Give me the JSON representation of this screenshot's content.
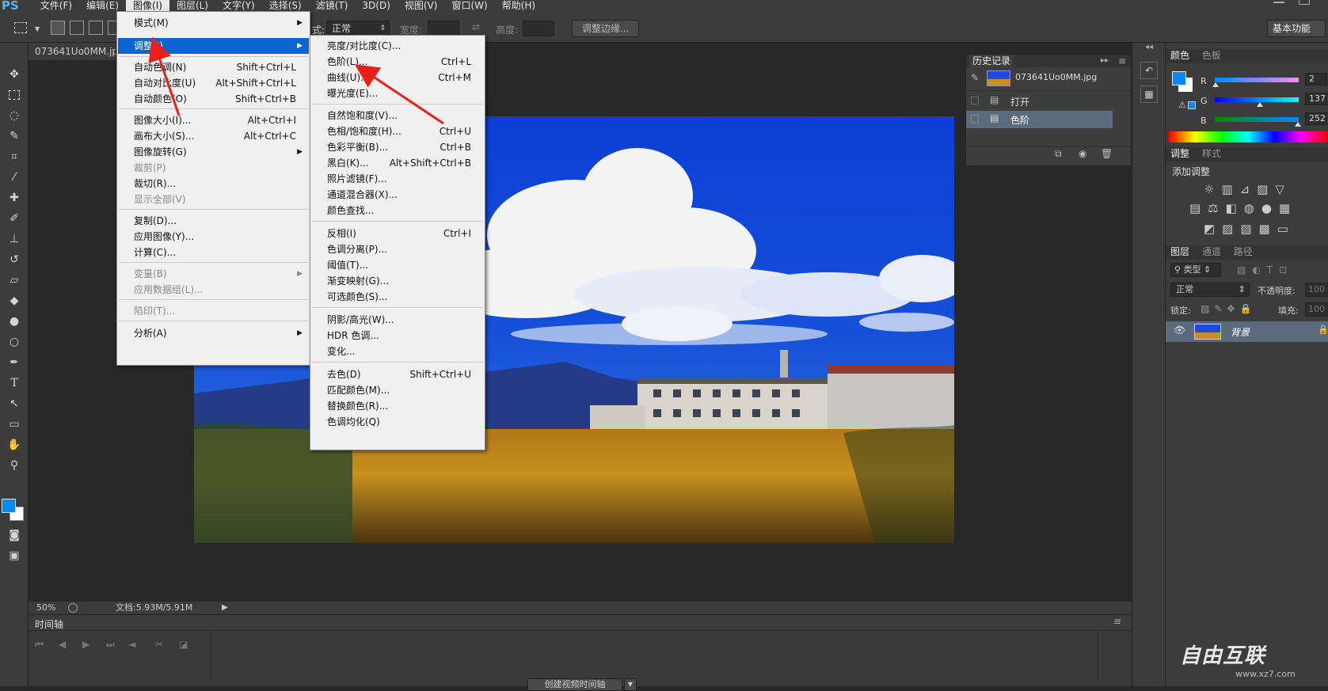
{
  "app": {
    "logo": "PS"
  },
  "menubar": [
    "文件(F)",
    "编辑(E)",
    "图像(I)",
    "图层(L)",
    "文字(Y)",
    "选择(S)",
    "滤镜(T)",
    "3D(D)",
    "视图(V)",
    "窗口(W)",
    "帮助(H)"
  ],
  "options": {
    "style_label": "式:",
    "style_value": "正常",
    "width_label": "宽度:",
    "height_label": "高度:",
    "refine_button": "调整边缘...",
    "workspace": "基本功能"
  },
  "document": {
    "tab_title": "073641Uo0MM.jpg",
    "zoom": "50%",
    "doc_info": "文档:5.93M/5.91M"
  },
  "timeline": {
    "title": "时间轴",
    "create_button": "创建视频时间轴"
  },
  "image_menu": [
    {
      "label": "模式(M)",
      "shortcut": "",
      "submenu": true,
      "disabled": false,
      "highlight": false
    },
    {
      "label": "调整(J)",
      "shortcut": "",
      "submenu": true,
      "disabled": false,
      "highlight": true
    },
    {
      "label": "自动色调(N)",
      "shortcut": "Shift+Ctrl+L",
      "submenu": false,
      "disabled": false,
      "highlight": false
    },
    {
      "label": "自动对比度(U)",
      "shortcut": "Alt+Shift+Ctrl+L",
      "submenu": false,
      "disabled": false,
      "highlight": false
    },
    {
      "label": "自动颜色(O)",
      "shortcut": "Shift+Ctrl+B",
      "submenu": false,
      "disabled": false,
      "highlight": false
    },
    {
      "label": "图像大小(I)...",
      "shortcut": "Alt+Ctrl+I",
      "submenu": false,
      "disabled": false,
      "highlight": false
    },
    {
      "label": "画布大小(S)...",
      "shortcut": "Alt+Ctrl+C",
      "submenu": false,
      "disabled": false,
      "highlight": false
    },
    {
      "label": "图像旋转(G)",
      "shortcut": "",
      "submenu": true,
      "disabled": false,
      "highlight": false
    },
    {
      "label": "裁剪(P)",
      "shortcut": "",
      "submenu": false,
      "disabled": true,
      "highlight": false
    },
    {
      "label": "裁切(R)...",
      "shortcut": "",
      "submenu": false,
      "disabled": false,
      "highlight": false
    },
    {
      "label": "显示全部(V)",
      "shortcut": "",
      "submenu": false,
      "disabled": true,
      "highlight": false
    },
    {
      "label": "复制(D)...",
      "shortcut": "",
      "submenu": false,
      "disabled": false,
      "highlight": false
    },
    {
      "label": "应用图像(Y)...",
      "shortcut": "",
      "submenu": false,
      "disabled": false,
      "highlight": false
    },
    {
      "label": "计算(C)...",
      "shortcut": "",
      "submenu": false,
      "disabled": false,
      "highlight": false
    },
    {
      "label": "变量(B)",
      "shortcut": "",
      "submenu": true,
      "disabled": true,
      "highlight": false
    },
    {
      "label": "应用数据组(L)...",
      "shortcut": "",
      "submenu": false,
      "disabled": true,
      "highlight": false
    },
    {
      "label": "陷印(T)...",
      "shortcut": "",
      "submenu": false,
      "disabled": true,
      "highlight": false
    },
    {
      "label": "分析(A)",
      "shortcut": "",
      "submenu": true,
      "disabled": false,
      "highlight": false
    }
  ],
  "adjust_menu": [
    {
      "label": "亮度/对比度(C)...",
      "shortcut": ""
    },
    {
      "label": "色阶(L)...",
      "shortcut": "Ctrl+L"
    },
    {
      "label": "曲线(U)...",
      "shortcut": "Ctrl+M"
    },
    {
      "label": "曝光度(E)...",
      "shortcut": ""
    },
    {
      "label": "自然饱和度(V)...",
      "shortcut": ""
    },
    {
      "label": "色相/饱和度(H)...",
      "shortcut": "Ctrl+U"
    },
    {
      "label": "色彩平衡(B)...",
      "shortcut": "Ctrl+B"
    },
    {
      "label": "黑白(K)...",
      "shortcut": "Alt+Shift+Ctrl+B"
    },
    {
      "label": "照片滤镜(F)...",
      "shortcut": ""
    },
    {
      "label": "通道混合器(X)...",
      "shortcut": ""
    },
    {
      "label": "颜色查找...",
      "shortcut": ""
    },
    {
      "label": "反相(I)",
      "shortcut": "Ctrl+I"
    },
    {
      "label": "色调分离(P)...",
      "shortcut": ""
    },
    {
      "label": "阈值(T)...",
      "shortcut": ""
    },
    {
      "label": "渐变映射(G)...",
      "shortcut": ""
    },
    {
      "label": "可选颜色(S)...",
      "shortcut": ""
    },
    {
      "label": "阴影/高光(W)...",
      "shortcut": ""
    },
    {
      "label": "HDR 色调...",
      "shortcut": ""
    },
    {
      "label": "变化...",
      "shortcut": ""
    },
    {
      "label": "去色(D)",
      "shortcut": "Shift+Ctrl+U"
    },
    {
      "label": "匹配颜色(M)...",
      "shortcut": ""
    },
    {
      "label": "替换颜色(R)...",
      "shortcut": ""
    },
    {
      "label": "色调均化(Q)",
      "shortcut": ""
    }
  ],
  "history": {
    "title": "历史记录",
    "snapshot": "073641Uo0MM.jpg",
    "items": [
      "打开",
      "色阶"
    ]
  },
  "color_panel": {
    "tabs": [
      "颜色",
      "色板"
    ],
    "r_label": "R",
    "g_label": "G",
    "b_label": "B",
    "r": "2",
    "g": "137",
    "b": "252",
    "r_level": 0.01,
    "g_level": 0.54,
    "b_level": 0.99,
    "fg_color": "#0289fc"
  },
  "adjust_panel": {
    "tabs": [
      "调整",
      "样式"
    ],
    "title": "添加调整"
  },
  "layers_panel": {
    "tabs": [
      "图层",
      "通道",
      "路径"
    ],
    "filter": "类型",
    "blend": "正常",
    "opacity_label": "不透明度:",
    "opacity": "100",
    "lock_label": "锁定:",
    "fill_label": "填充:",
    "fill": "100",
    "layer_name": "背景"
  },
  "watermark": {
    "text": "自由互联",
    "sub": "www.xz7.com"
  }
}
